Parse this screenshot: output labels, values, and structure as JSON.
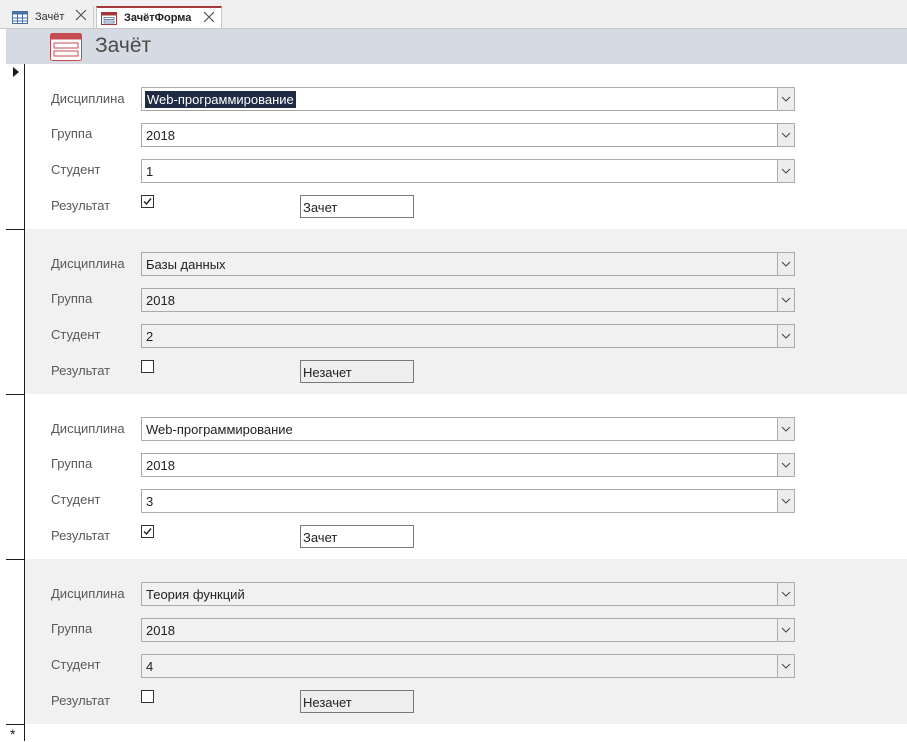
{
  "tabs": [
    {
      "label": "Зачёт",
      "icon": "table-icon",
      "active": false
    },
    {
      "label": "ЗачётФорма",
      "icon": "form-icon",
      "active": true
    }
  ],
  "header": {
    "title": "Зачёт",
    "icon": "form-icon"
  },
  "labels": {
    "discipline": "Дисциплина",
    "group": "Группа",
    "student": "Студент",
    "result": "Результат"
  },
  "records": [
    {
      "discipline": "Web-программирование",
      "group": "2018",
      "student": "1",
      "passed": true,
      "result_text": "Зачет"
    },
    {
      "discipline": "Базы данных",
      "group": "2018",
      "student": "2",
      "passed": false,
      "result_text": "Незачет"
    },
    {
      "discipline": "Web-программирование",
      "group": "2018",
      "student": "3",
      "passed": true,
      "result_text": "Зачет"
    },
    {
      "discipline": "Теория функций",
      "group": "2018",
      "student": "4",
      "passed": false,
      "result_text": "Незачет"
    }
  ],
  "new_record_marker": "*",
  "colors": {
    "accent_tab": "#a4373a",
    "header_band": "#d6dbe3",
    "alt_row": "#f1f1f1"
  }
}
